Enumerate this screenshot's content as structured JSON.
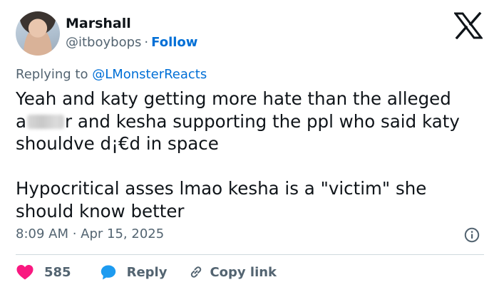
{
  "author": {
    "name": "Marshall",
    "handle": "@itboybops",
    "separator": "·",
    "follow_label": "Follow"
  },
  "reply_context": {
    "prefix": "Replying to ",
    "mention": "@LMonsterReacts"
  },
  "post": {
    "line1": "Yeah and katy getting more hate than the alleged",
    "line2_before": "a",
    "line2_after": "r and kesha supporting the ppl who said katy",
    "line3": "shouldve d¡€d in space",
    "line4": "Hypocritical asses lmao kesha is a \"victim\" she",
    "line5": "should know better"
  },
  "meta": {
    "timestamp": "8:09 AM · Apr 15, 2025"
  },
  "actions": {
    "like_count": "585",
    "reply_label": "Reply",
    "copy_label": "Copy link"
  },
  "icons": {
    "platform": "x-logo-icon",
    "info": "info-icon",
    "like": "heart-icon",
    "reply": "speech-bubble-icon",
    "copy": "link-icon"
  },
  "colors": {
    "link": "#006fd6",
    "secondary_text": "#536471",
    "like": "#f91880",
    "reply": "#1d9bf0"
  }
}
